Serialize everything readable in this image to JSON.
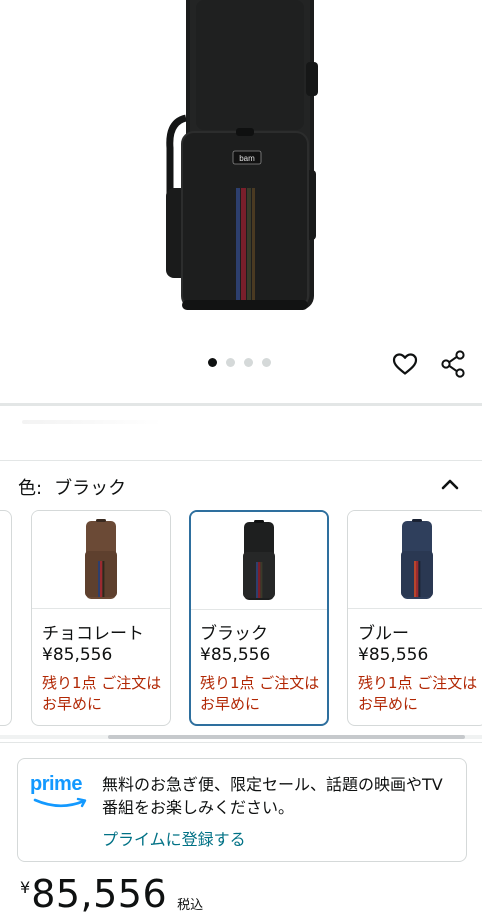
{
  "product": {
    "image_alt": "bam case",
    "brand_label": "bam"
  },
  "carousel": {
    "dot_count": 4,
    "active_index": 0
  },
  "actions": {
    "favorite_icon": "heart-icon",
    "share_icon": "share-icon"
  },
  "color_selector": {
    "label": "色:",
    "selected": "ブラック",
    "collapse_icon": "chevron-up-icon",
    "options": [
      {
        "name": "チョコレート",
        "price": "¥85,556",
        "stock": "残り1点 ご注文はお早めに",
        "color": "#6b4a36"
      },
      {
        "name": "ブラック",
        "price": "¥85,556",
        "stock": "残り1点 ご注文はお早めに",
        "color": "#1e1f1f"
      },
      {
        "name": "ブルー",
        "price": "¥85,556",
        "stock": "残り1点 ご注文はお早めに",
        "color": "#2f3f5c"
      }
    ]
  },
  "prime": {
    "logo": "prime",
    "message": "無料のお急ぎ便、限定セール、話題の映画やTV番組をお楽しみください。",
    "link": "プライムに登録する"
  },
  "price": {
    "currency": "¥",
    "amount": "85,556",
    "tax": "税込"
  },
  "colors": {
    "stock_red": "#b12704",
    "link_teal": "#007185",
    "selected_border": "#2e6f9e",
    "prime_blue": "#1399ff"
  }
}
